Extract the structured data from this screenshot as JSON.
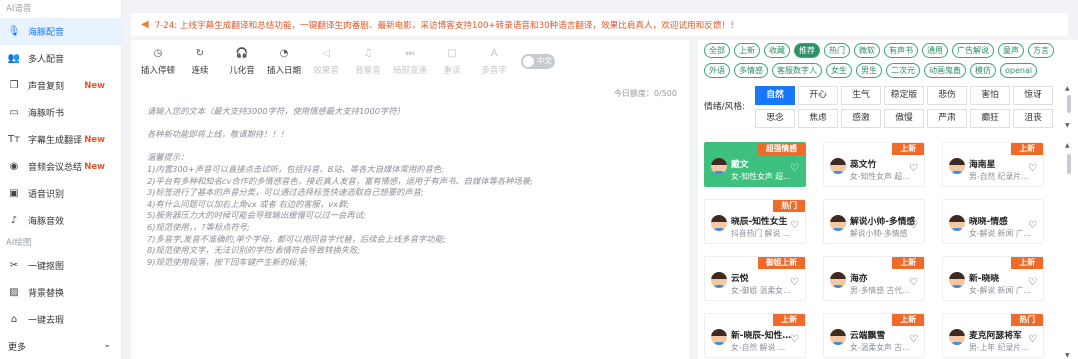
{
  "sidebar": {
    "group_audio": "AI语音",
    "items": [
      {
        "label": "海豚配音",
        "icon": "mic-icon",
        "glyph": "🎙",
        "new": "",
        "active": true
      },
      {
        "label": "多人配音",
        "icon": "users-icon",
        "glyph": "👥",
        "new": "",
        "active": false
      },
      {
        "label": "声音复刻",
        "icon": "copy-icon",
        "glyph": "❐",
        "new": "New",
        "active": false
      },
      {
        "label": "海豚听书",
        "icon": "book-icon",
        "glyph": "▭",
        "new": "",
        "active": false
      },
      {
        "label": "字幕生成翻译",
        "icon": "text-icon",
        "glyph": "Tт",
        "new": "New",
        "active": false
      },
      {
        "label": "音频会议总结",
        "icon": "audio-icon",
        "glyph": "◉",
        "new": "New",
        "active": false
      },
      {
        "label": "语音识别",
        "icon": "scan-icon",
        "glyph": "▣",
        "new": "",
        "active": false
      },
      {
        "label": "海豚音效",
        "icon": "voice-icon",
        "glyph": "♪",
        "new": "",
        "active": false
      }
    ],
    "group_image": "AI绘图",
    "image_items": [
      {
        "label": "一键抠图",
        "icon": "scissors-icon",
        "glyph": "✂"
      },
      {
        "label": "背景替换",
        "icon": "image-icon",
        "glyph": "▨"
      },
      {
        "label": "一键去瑕",
        "icon": "brush-icon",
        "glyph": "⌂"
      }
    ],
    "more": "更多"
  },
  "notice": {
    "icon": "megaphone-icon",
    "text": "7-24: 上线字幕生成翻译和总结功能，一键翻译生肉番剧、最新电影，采访博客支持100+转录语音和30种语言翻译，效果比肩真人，欢迎试用和反馈！！"
  },
  "toolbar": {
    "tools": [
      {
        "label": "插入停顿",
        "icon": "pause-icon",
        "glyph": "◷",
        "disabled": false
      },
      {
        "label": "连续",
        "icon": "refresh-icon",
        "glyph": "↻",
        "disabled": false
      },
      {
        "label": "儿化音",
        "icon": "headphone-icon",
        "glyph": "🎧",
        "disabled": false
      },
      {
        "label": "插入日期",
        "icon": "clock-icon",
        "glyph": "◔",
        "disabled": false
      },
      {
        "label": "效果音",
        "icon": "sound-icon",
        "glyph": "◁",
        "disabled": true
      },
      {
        "label": "背景音",
        "icon": "mic-icon",
        "glyph": "♫",
        "disabled": true
      },
      {
        "label": "局部变速",
        "icon": "speed-icon",
        "glyph": "⏭",
        "disabled": true
      },
      {
        "label": "重读",
        "icon": "square-icon",
        "glyph": "□",
        "disabled": true
      },
      {
        "label": "多音字",
        "icon": "pinyin-icon",
        "glyph": "A",
        "disabled": true
      }
    ],
    "toggle_label": "中文"
  },
  "editor": {
    "counter": "今日额度：0/500",
    "lines": [
      "请输入您的文本（最大支持3000字符，使用情感最大支持1000字符）",
      "",
      "各种新功能即将上线，敬请期待！！！",
      "",
      "温馨提示：",
      "1)内置300+声音可以直接点击试听，包括抖音、B站、等各大自媒体常用的音色;",
      "2)平台有多种和知名cv合作的多情感音色，接近真人发音，富有情感，适用于有声书、自媒体等各种场景;",
      "3)标签进行了基本的声音分类，可以通过选择标签快速选取自己想要的声音;",
      "4)有什么问题可以加右上角vx 或者 右边的客服，vx群;",
      "5)服务器压力大的时候可能会导致输出缓慢可以过一会再试;",
      "6)规范使用，，?等标点符号;",
      "7)多音字,发音不准确的,单个字母，都可以用同音字代替，后续会上线多音字功能;",
      "8)规范使用文字，无法识别的字符/表情符会导致转换失败;",
      "9)规范使用段落，按下回车键产生新的段落;"
    ]
  },
  "voice_panel": {
    "tag_rows": [
      [
        "全部",
        "上新",
        "收藏",
        "推荐",
        "热门",
        "微软",
        "有声书",
        "通用",
        "广告解说",
        "童声",
        "方言"
      ],
      [
        "外语",
        "多情感",
        "客服数字人",
        "女生",
        "男生",
        "二次元",
        "动画鬼畜",
        "模仿",
        "openai"
      ]
    ],
    "active_tag": "推荐",
    "emotion_label": "情绪/风格:",
    "emotions": [
      [
        "自然",
        "开心",
        "生气",
        "稳定版",
        "悲伤",
        "害怕",
        "惊讶"
      ],
      [
        "思念",
        "焦虑",
        "感激",
        "傲慢",
        "严肃",
        "癫狂",
        "沮丧"
      ]
    ],
    "active_emotion": "自然",
    "cards": [
      {
        "name": "戴文",
        "sub": "女-知性女声 超...",
        "badge": "超强情感",
        "badge_color": "#f06a2a",
        "selected": true
      },
      {
        "name": "蕊文竹",
        "sub": "女-知性女声 超...",
        "badge": "上新",
        "badge_color": "#f06a2a",
        "selected": false
      },
      {
        "name": "海南星",
        "sub": "男-自然 纪录片...",
        "badge": "上新",
        "badge_color": "#f06a2a",
        "selected": false
      },
      {
        "name": "晓辰-知性女生",
        "sub": "抖音热门 解说 ...",
        "badge": "热门",
        "badge_color": "#f06a2a",
        "selected": false
      },
      {
        "name": "解说小帅-多情感",
        "sub": "解说小帅-多情感",
        "badge": "",
        "badge_color": "",
        "selected": false
      },
      {
        "name": "晓晓-情感",
        "sub": "女-解说 新闻 广...",
        "badge": "",
        "badge_color": "",
        "selected": false
      },
      {
        "name": "云悦",
        "sub": "女-御姐 温柔女...",
        "badge": "御姐上新",
        "badge_color": "#f06a2a",
        "selected": false
      },
      {
        "name": "海亦",
        "sub": "男-多情感 古代...",
        "badge": "上新",
        "badge_color": "#f06a2a",
        "selected": false
      },
      {
        "name": "新-晓晓",
        "sub": "女-解说 新闻 广...",
        "badge": "上新",
        "badge_color": "#f06a2a",
        "selected": false
      },
      {
        "name": "新-晓辰-知性女...",
        "sub": "女-自然 解说 ...",
        "badge": "上新",
        "badge_color": "#f06a2a",
        "selected": false
      },
      {
        "name": "云端飘雪",
        "sub": "女-温柔女声 古...",
        "badge": "上新",
        "badge_color": "#f06a2a",
        "selected": false
      },
      {
        "name": "麦克阿瑟将军",
        "sub": "男-上年 纪录片...",
        "badge": "热门",
        "badge_color": "#f06a2a",
        "selected": false
      }
    ]
  }
}
